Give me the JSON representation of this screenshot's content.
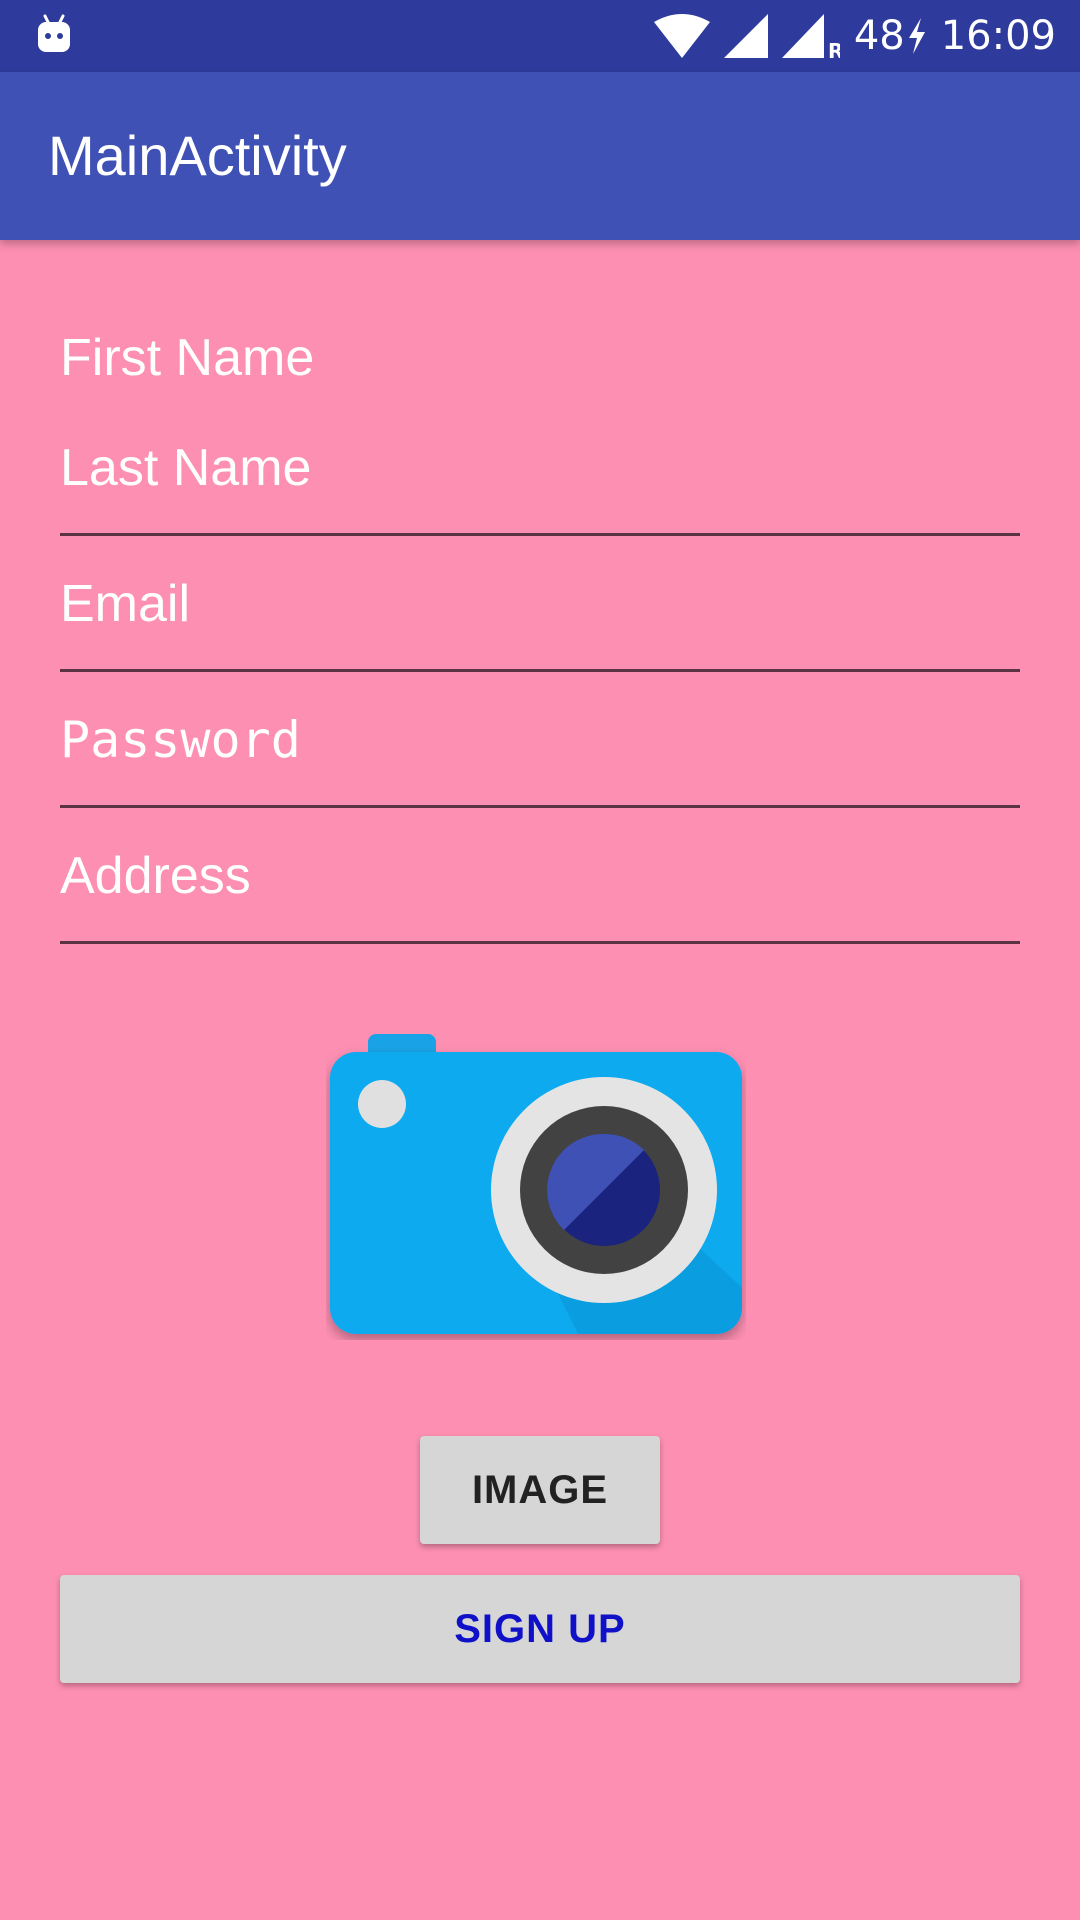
{
  "status_bar": {
    "battery_level": "48",
    "time": "16:09",
    "icons": [
      "android-notification-icon",
      "wifi-icon",
      "cell-signal-icon",
      "cell-signal-roaming-icon",
      "charging-icon"
    ]
  },
  "app_bar": {
    "title": "MainActivity"
  },
  "form": {
    "first_name": {
      "placeholder": "First Name",
      "value": ""
    },
    "last_name": {
      "placeholder": "Last Name",
      "value": ""
    },
    "email": {
      "placeholder": "Email",
      "value": ""
    },
    "password": {
      "placeholder": "Password",
      "value": ""
    },
    "address": {
      "placeholder": "Address",
      "value": ""
    }
  },
  "image_preview": {
    "icon": "camera-icon"
  },
  "buttons": {
    "image_label": "IMAGE",
    "signup_label": "SIGN UP"
  },
  "colors": {
    "background": "#fd8fb2",
    "app_bar": "#3f51b5",
    "status_bar": "#2e3b9c",
    "button": "#d6d6d6",
    "signup_text": "#1010c8"
  }
}
